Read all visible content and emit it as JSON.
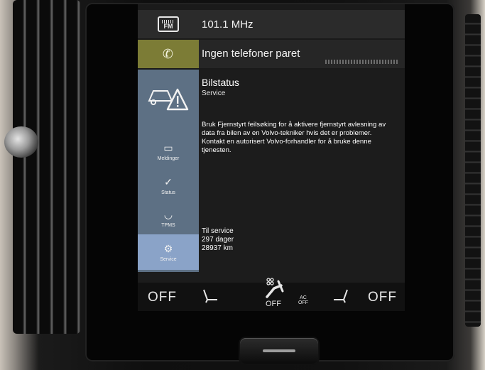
{
  "radio": {
    "frequency": "101.1 MHz",
    "icon": "fm-radio-icon",
    "icon_text": "FM"
  },
  "phone": {
    "status": "Ingen telefoner paret",
    "icon": "phone-icon",
    "accent": "#7c7c36"
  },
  "car_status": {
    "title": "Bilstatus",
    "subtitle": "Service",
    "description": "Bruk Fjernstyrt feilsøking for å aktivere fjernstyrt avlesning av data fra bilen av en Volvo-tekniker hvis det er problemer. Kontakt en autorisert Volvo-forhandler for å bruke denne tjenesten.",
    "service_info": {
      "label": "Til service",
      "days": "297 dager",
      "distance": "28937 km"
    }
  },
  "side_nav": {
    "items": [
      {
        "label": "Meldinger",
        "icon": "message-icon"
      },
      {
        "label": "Status",
        "icon": "status-icon"
      },
      {
        "label": "TPMS",
        "icon": "tire-icon"
      },
      {
        "label": "Service",
        "icon": "service-icon",
        "selected": true
      }
    ],
    "bg_color": "#5d7084",
    "selected_color": "#8aa3c8"
  },
  "climate": {
    "left_temp": "OFF",
    "right_temp": "OFF",
    "fan_status": "OFF",
    "ac_label_top": "AC",
    "ac_label_bottom": "OFF"
  }
}
